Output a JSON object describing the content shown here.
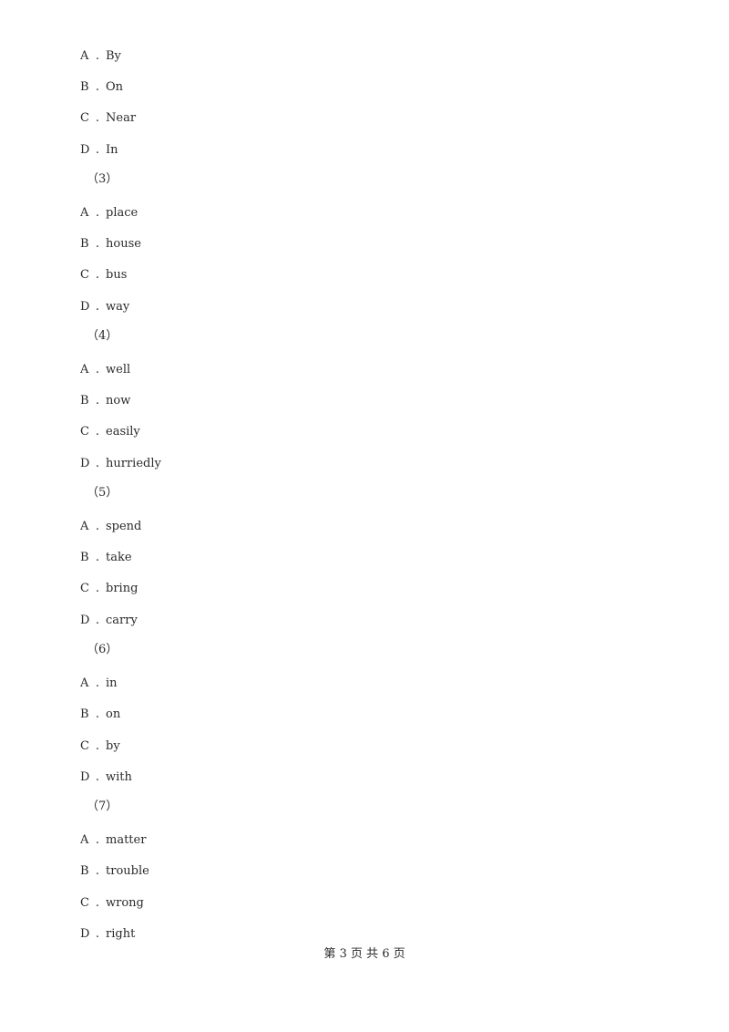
{
  "blocks": [
    {
      "type": "options",
      "options": [
        {
          "letter": "A",
          "text": "By"
        },
        {
          "letter": "B",
          "text": "On"
        },
        {
          "letter": "C",
          "text": "Near"
        },
        {
          "letter": "D",
          "text": "In"
        }
      ]
    },
    {
      "type": "question",
      "number": "（3）",
      "options": [
        {
          "letter": "A",
          "text": "place"
        },
        {
          "letter": "B",
          "text": "house"
        },
        {
          "letter": "C",
          "text": "bus"
        },
        {
          "letter": "D",
          "text": "way"
        }
      ]
    },
    {
      "type": "question",
      "number": "（4）",
      "options": [
        {
          "letter": "A",
          "text": "well"
        },
        {
          "letter": "B",
          "text": "now"
        },
        {
          "letter": "C",
          "text": "easily"
        },
        {
          "letter": "D",
          "text": "hurriedly"
        }
      ]
    },
    {
      "type": "question",
      "number": "（5）",
      "options": [
        {
          "letter": "A",
          "text": "spend"
        },
        {
          "letter": "B",
          "text": "take"
        },
        {
          "letter": "C",
          "text": "bring"
        },
        {
          "letter": "D",
          "text": "carry"
        }
      ]
    },
    {
      "type": "question",
      "number": "（6）",
      "options": [
        {
          "letter": "A",
          "text": "in"
        },
        {
          "letter": "B",
          "text": "on"
        },
        {
          "letter": "C",
          "text": "by"
        },
        {
          "letter": "D",
          "text": "with"
        }
      ]
    },
    {
      "type": "question",
      "number": "（7）",
      "options": [
        {
          "letter": "A",
          "text": "matter"
        },
        {
          "letter": "B",
          "text": "trouble"
        },
        {
          "letter": "C",
          "text": "wrong"
        },
        {
          "letter": "D",
          "text": "right"
        }
      ]
    }
  ],
  "separator": ".",
  "footer": {
    "text": "第 3 页 共 6 页"
  }
}
